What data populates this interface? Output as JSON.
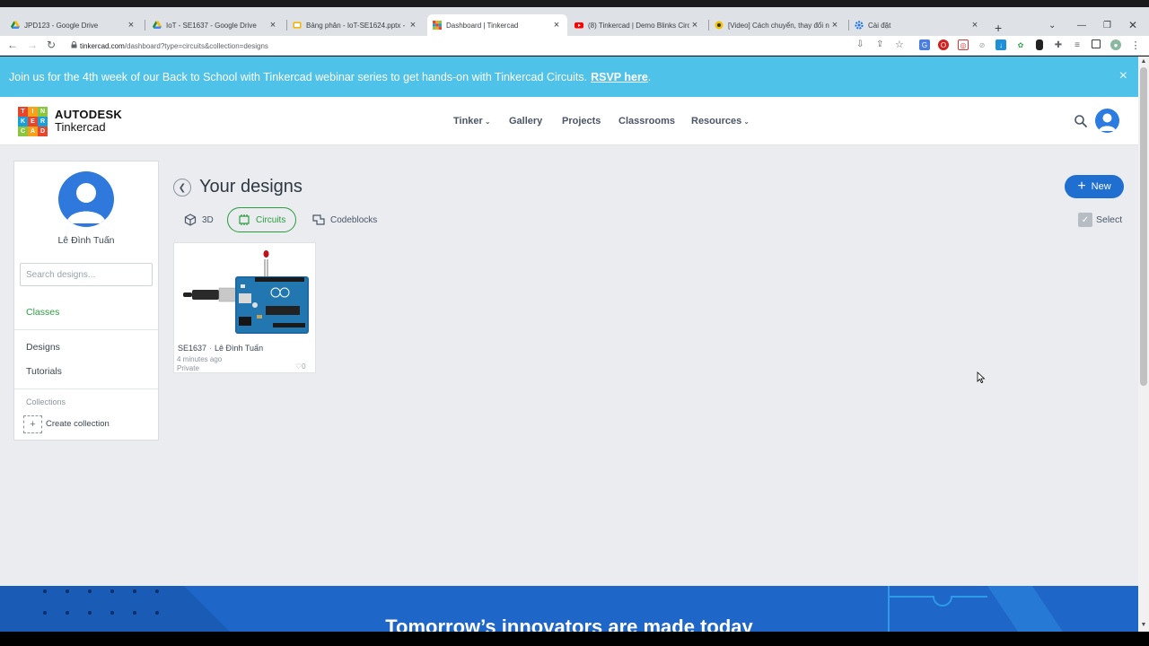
{
  "browser": {
    "tabs": [
      {
        "title": "JPD123 - Google Drive",
        "icon": "google-drive-icon"
      },
      {
        "title": "IoT - SE1637 - Google Drive",
        "icon": "google-drive-icon"
      },
      {
        "title": "Bảng phân - IoT-SE1624.pptx - ...",
        "icon": "google-slides-icon"
      },
      {
        "title": "Dashboard | Tinkercad",
        "icon": "tinkercad-icon"
      },
      {
        "title": "(8) Tinkercad | Demo Blinks Circ...",
        "icon": "youtube-icon"
      },
      {
        "title": "[Video] Cách chuyển, thay đổi n...",
        "icon": "web-icon"
      },
      {
        "title": "Cài đặt",
        "icon": "settings-icon"
      }
    ],
    "new_tab": "+",
    "url_host": "tinkercad.com",
    "url_path": "/dashboard?type=circuits&collection=designs"
  },
  "banner": {
    "text": "Join us for the 4th week of our Back to School with Tinkercad webinar series to get hands-on with Tinkercad Circuits.",
    "link": "RSVP here",
    "after_link": ".",
    "close": "×"
  },
  "header": {
    "logo_letters": [
      "T",
      "I",
      "N",
      "K",
      "E",
      "R",
      "C",
      "A",
      "D"
    ],
    "brand_line1": "AUTODESK",
    "brand_line2": "Tinkercad",
    "nav": {
      "tinker": "Tinker",
      "gallery": "Gallery",
      "projects": "Projects",
      "classrooms": "Classrooms",
      "resources": "Resources"
    }
  },
  "sidebar": {
    "user_name": "Lê Đình Tuấn",
    "search_placeholder": "Search designs...",
    "classes": "Classes",
    "designs": "Designs",
    "tutorials": "Tutorials",
    "collections_heading": "Collections",
    "add_symbol": "+",
    "create_collection": "Create collection"
  },
  "main": {
    "title": "Your designs",
    "tabs": {
      "three_d": "3D",
      "circuits": "Circuits",
      "codeblocks": "Codeblocks"
    },
    "active_tab": "Circuits",
    "new_button": "New",
    "select_label": "Select",
    "design": {
      "name": "SE1637",
      "owner": "Lê Đình Tuấn",
      "time": "4 minutes ago",
      "privacy": "Private",
      "likes": "0"
    }
  },
  "footer": {
    "headline": "Tomorrow’s innovators are made today"
  },
  "colors": {
    "banner": "#4fc2ea",
    "accent_green": "#2a9d3e",
    "primary_blue": "#1f6fd0",
    "footer_blue": "#1a5bb5"
  }
}
